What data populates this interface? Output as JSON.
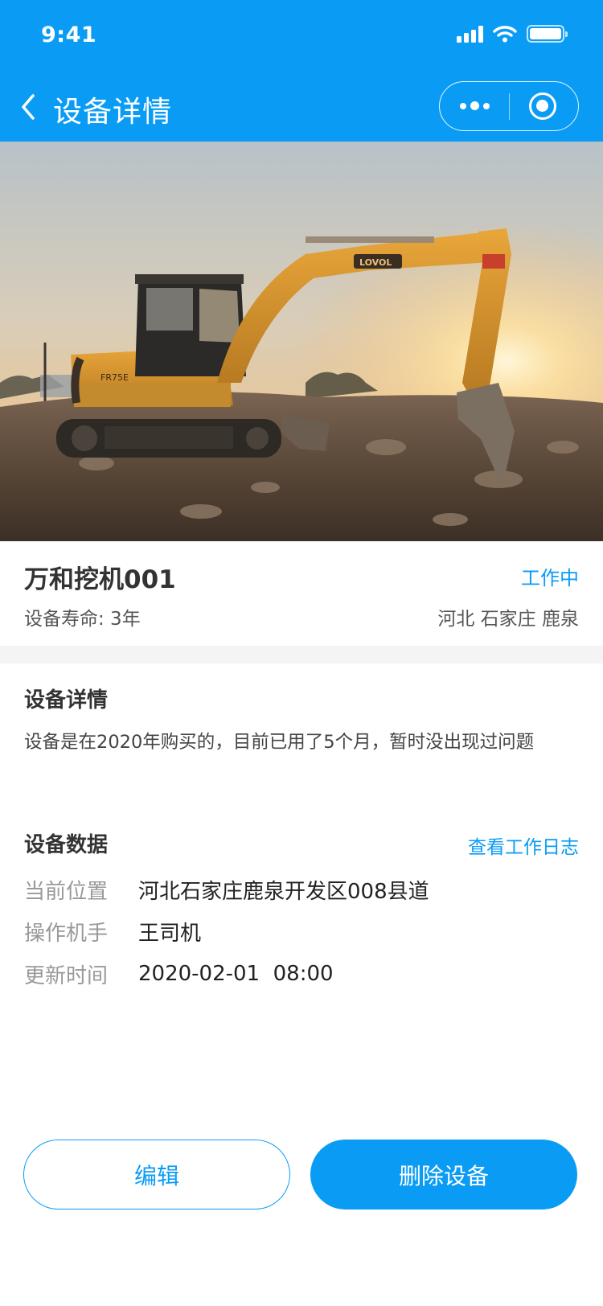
{
  "status_bar": {
    "time": "9:41"
  },
  "nav": {
    "title": "设备详情"
  },
  "device": {
    "name": "万和挖机001",
    "status": "工作中",
    "life": "设备寿命: 3年",
    "region": "河北 石家庄 鹿泉"
  },
  "details": {
    "title": "设备详情",
    "text": "设备是在2020年购买的，目前已用了5个月，暂时没出现过问题"
  },
  "data_section": {
    "title": "设备数据",
    "log_link": "查看工作日志",
    "rows": [
      {
        "label": "当前位置",
        "value": "河北石家庄鹿泉开发区008县道"
      },
      {
        "label": "操作机手",
        "value": "王司机"
      },
      {
        "label": "更新时间",
        "value": "2020-02-01  08:00"
      }
    ]
  },
  "buttons": {
    "edit": "编辑",
    "delete": "删除设备"
  },
  "hero_image": {
    "brand_text": "LOVOL",
    "model_text": "FR75E"
  },
  "colors": {
    "primary": "#0a9cf5",
    "text": "#333333",
    "muted": "#999999",
    "divider": "#f4f4f4"
  }
}
